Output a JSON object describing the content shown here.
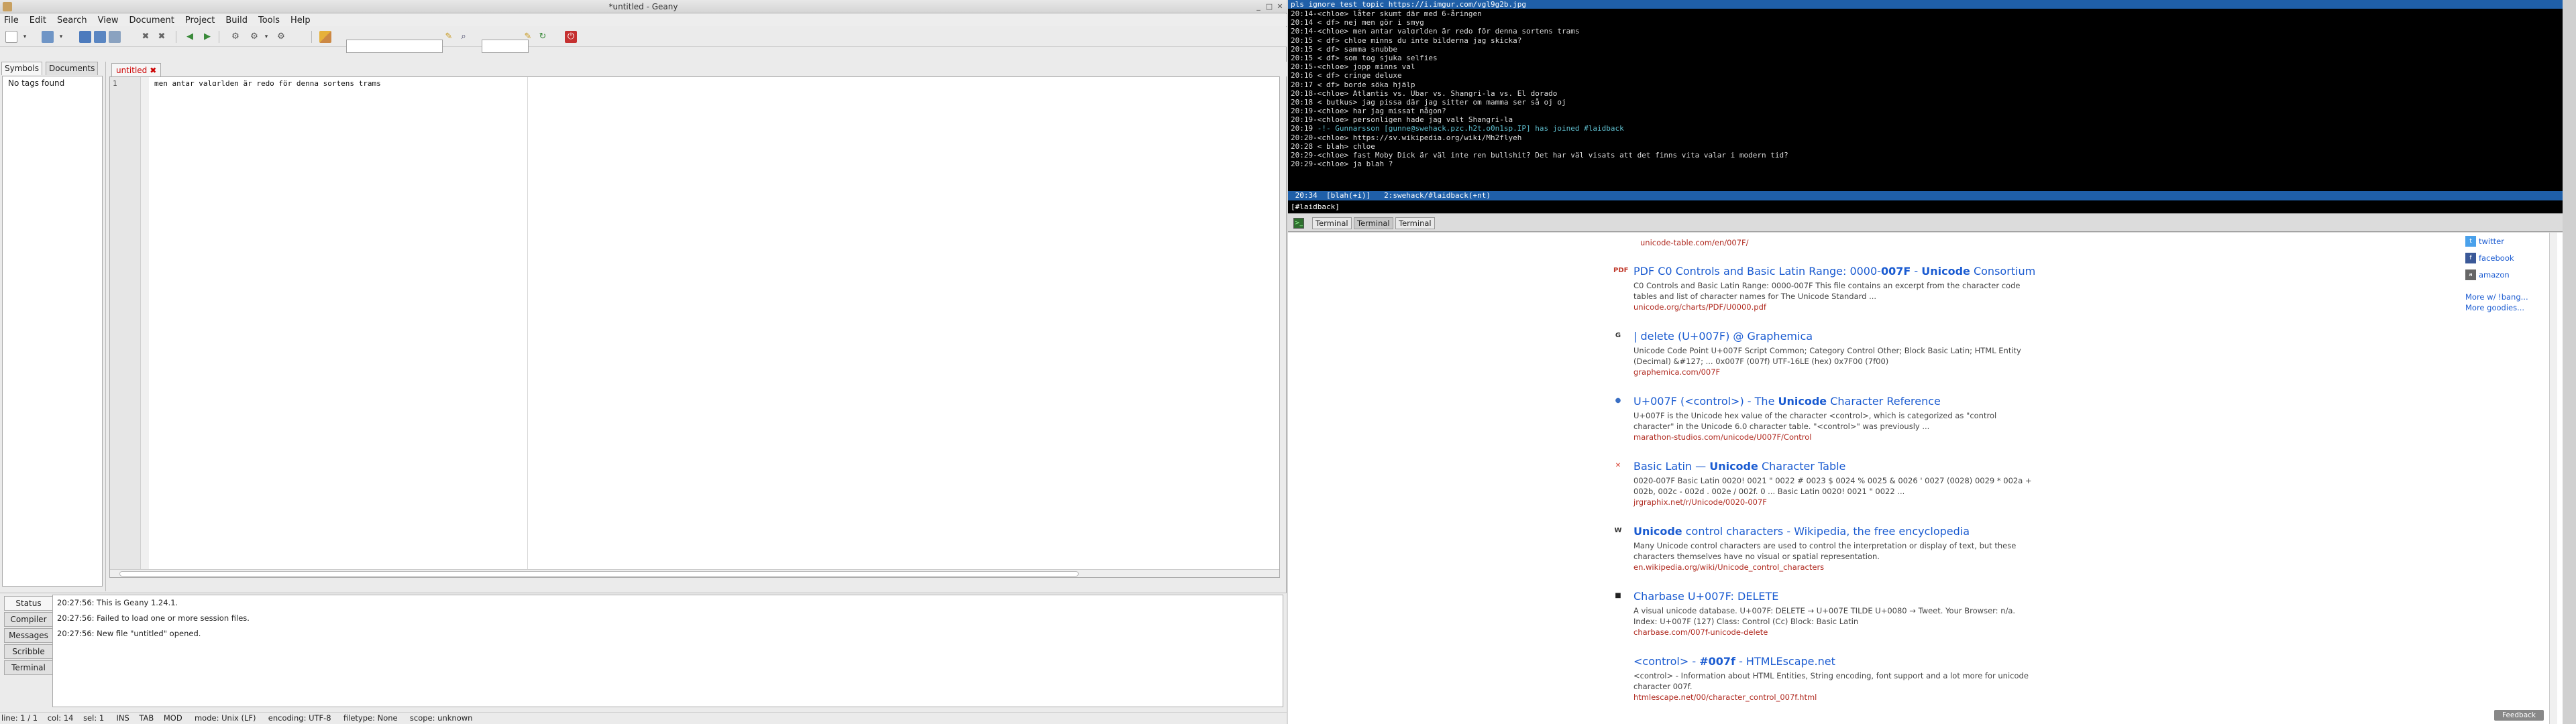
{
  "geany": {
    "window_title": "*untitled - Geany",
    "menu": [
      "File",
      "Edit",
      "Search",
      "View",
      "Document",
      "Project",
      "Build",
      "Tools",
      "Help"
    ],
    "sidebar_tabs": [
      "Symbols",
      "Documents"
    ],
    "sidebar_empty": "No tags found",
    "editor_tab": "untitled",
    "line_number": "1",
    "code_line": "men antar valɑrlden är redo för denna sortens trams",
    "message_tabs": [
      "Status",
      "Compiler",
      "Messages",
      "Scribble",
      "Terminal"
    ],
    "messages": [
      "20:27:56: This is Geany 1.24.1.",
      "20:27:56: Failed to load one or more session files.",
      "20:27:56: New file \"untitled\" opened."
    ],
    "statusbar": "line: 1 / 1    col: 14    sel: 1     INS    TAB    MOD     mode: Unix (LF)     encoding: UTF-8     filetype: None     scope: unknown"
  },
  "irc": {
    "topic": "pls ignore test topic https://i.imgur.com/vgl9g2b.jpg",
    "lines": [
      {
        "t": "20:14",
        "n": "-<chloe>",
        "m": " låter skumt där med 6-åringen"
      },
      {
        "t": "20:14",
        "n": " < df>",
        "m": " nej men gör i smyg"
      },
      {
        "t": "20:14",
        "n": "-<chloe>",
        "m": " men antar valɑrlden är redo för denna sortens trams"
      },
      {
        "t": "20:15",
        "n": " < df>",
        "m": " chloe minns du inte bilderna jag skicka?"
      },
      {
        "t": "20:15",
        "n": " < df>",
        "m": " samma snubbe"
      },
      {
        "t": "20:15",
        "n": " < df>",
        "m": " som tog sjuka selfies"
      },
      {
        "t": "20:15",
        "n": "-<chloe>",
        "m": " jopp minns val"
      },
      {
        "t": "20:16",
        "n": " < df>",
        "m": " cringe deluxe"
      },
      {
        "t": "20:17",
        "n": " < df>",
        "m": " borde söka hjälp"
      },
      {
        "t": "20:18",
        "n": "-<chloe>",
        "m": " Atlantis vs. Ubar vs. Shangri-la vs. El dorado"
      },
      {
        "t": "20:18",
        "n": " < butkus>",
        "m": " jag pissa där jag sitter om mamma ser så oj oj"
      },
      {
        "t": "20:19",
        "n": "-<chloe>",
        "m": " har jag missat någon?"
      },
      {
        "t": "20:19",
        "n": "-<chloe>",
        "m": " personligen hade jag valt Shangri-la"
      },
      {
        "t": "20:19",
        "n": " -!-",
        "m": " Gunnarsson [gunne@swehack.pzc.h2t.o0n1sp.IP] has joined #laidback",
        "join": true
      },
      {
        "t": "20:20",
        "n": "-<chloe>",
        "m": " https://sv.wikipedia.org/wiki/Mh2flyeh"
      },
      {
        "t": "20:28",
        "n": " < blah>",
        "m": " chloe"
      },
      {
        "t": "20:29",
        "n": "-<chloe>",
        "m": " fast Moby Dick är väl inte ren bullshit? Det har väl visats att det finns vita valar i modern tid?"
      },
      {
        "t": "20:29",
        "n": "-<chloe>",
        "m": " ja blah ?"
      }
    ],
    "statusline": " 20:34  [blah(+i)]   2:swehack/#laidback(+nt)",
    "input_prompt": "[#laidback]",
    "terminal_tabs": [
      "Terminal",
      "Terminal",
      "Terminal"
    ]
  },
  "browser": {
    "top_url": "unicode-table.com/en/007F/",
    "results": [
      {
        "fav": "PDF",
        "favc": "#c0392b",
        "title_pre": "PDF C0 Controls and Basic Latin Range: 0000-",
        "title_b": "007F",
        "title_mid": " - ",
        "title_b2": "Unicode",
        "title_post": " Consortium",
        "snippet": "C0 Controls and Basic Latin Range: 0000-007F This file contains an excerpt from the character code tables and list of character names for The Unicode Standard ...",
        "url": "unicode.org/charts/PDF/U0000.pdf"
      },
      {
        "fav": "G",
        "favc": "#333",
        "title_pre": "| delete (U+007F) @ Graphemica",
        "title_b": "",
        "title_mid": "",
        "title_b2": "",
        "title_post": "",
        "snippet": "Unicode Code Point U+007F Script Common; Category Control Other; Block Basic Latin; HTML Entity (Decimal) &#127; ... 0x007F (007f) UTF-16LE (hex) 0x7F00 (7f00)",
        "url": "graphemica.com/007F"
      },
      {
        "fav": "●",
        "favc": "#3a6fc4",
        "title_pre": "U+007F (<control>) - The ",
        "title_b": "Unicode",
        "title_mid": "",
        "title_b2": "",
        "title_post": " Character Reference",
        "snippet": "U+007F is the Unicode hex value of the character <control>, which is categorized as \"control character\" in the Unicode 6.0 character table. \"<control>\" was previously ...",
        "url": "marathon-studios.com/unicode/U007F/Control"
      },
      {
        "fav": "✕",
        "favc": "#d63a2a",
        "title_pre": "Basic Latin — ",
        "title_b": "Unicode",
        "title_mid": "",
        "title_b2": "",
        "title_post": " Character Table",
        "snippet": "0020-007F Basic Latin 0020! 0021 \" 0022 # 0023 $ 0024 % 0025 & 0026 ' 0027 (0028) 0029 * 002a + 002b, 002c - 002d . 002e / 002f. 0 ... Basic Latin 0020! 0021 \" 0022 ...",
        "url": "jrgraphix.net/r/Unicode/0020-007F"
      },
      {
        "fav": "W",
        "favc": "#333",
        "title_pre": "",
        "title_b": "Unicode",
        "title_mid": " control characters - Wikipedia, the free encyclopedia",
        "title_b2": "",
        "title_post": "",
        "snippet": "Many Unicode control characters are used to control the interpretation or display of text, but these characters themselves have no visual or spatial representation.",
        "url": "en.wikipedia.org/wiki/Unicode_control_characters"
      },
      {
        "fav": "■",
        "favc": "#222",
        "title_pre": "Charbase U+007F: DELETE",
        "title_b": "",
        "title_mid": "",
        "title_b2": "",
        "title_post": "",
        "snippet": "A visual unicode database. U+007F: DELETE → U+007E TILDE U+0080 → Tweet. Your Browser: n/a. Index: U+007F (127) Class: Control (Cc) Block: Basic Latin",
        "url": "charbase.com/007f-unicode-delete"
      },
      {
        "fav": "",
        "favc": "#fff",
        "title_pre": "<control> - ",
        "title_b": "#007f",
        "title_mid": "",
        "title_b2": "",
        "title_post": " - HTMLEscape.net",
        "snippet": "<control> - Information about HTML Entities, String encoding, font support and a lot more for unicode character 007f.",
        "url": "htmlescape.net/00/character_control_007f.html"
      }
    ],
    "side_links": [
      {
        "label": "twitter",
        "icon": "t",
        "color": "#4aa1eb"
      },
      {
        "label": "facebook",
        "icon": "f",
        "color": "#3b5998"
      },
      {
        "label": "amazon",
        "icon": "a",
        "color": "#666"
      }
    ],
    "more_links": [
      "More w/ !bang...",
      "More goodies..."
    ],
    "feedback": "Feedback"
  }
}
